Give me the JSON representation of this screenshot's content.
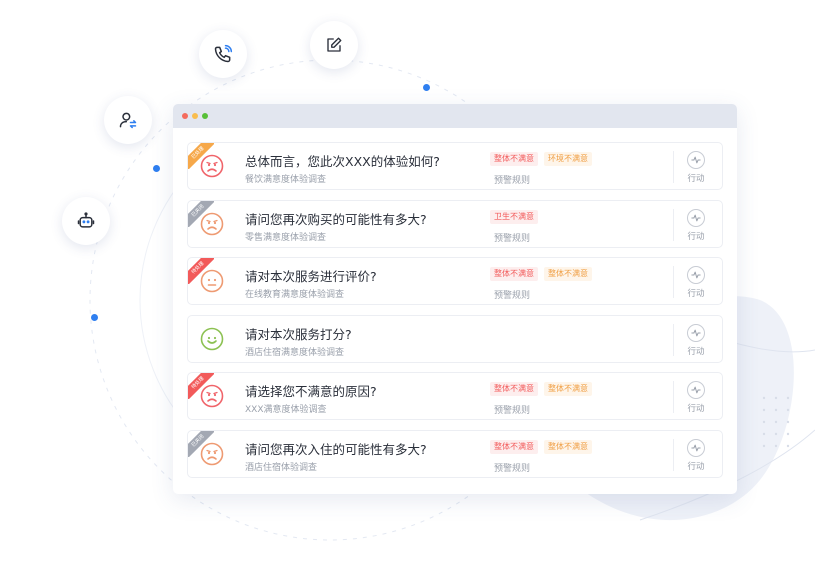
{
  "colors": {
    "accent": "#2f7ff0",
    "red_face": "#f0646a",
    "orange_face": "#ee9a72",
    "green_face": "#8cc152"
  },
  "side_icons": [
    "phone-icon",
    "edit-icon",
    "user-switch-icon",
    "robot-icon"
  ],
  "window": {
    "traffic_lights": [
      "#f46b5d",
      "#f9bd4e",
      "#57c038"
    ]
  },
  "rows": [
    {
      "ribbon": "已处理",
      "ribbon_color": "#f6a84a",
      "face": "sad",
      "face_color": "#f0646a",
      "question": "总体而言，您此次XXX的体验如何?",
      "survey": "餐饮满意度体验调查",
      "tags": [
        {
          "text": "整体不满意",
          "style": "red"
        },
        {
          "text": "环境不满意",
          "style": "orange"
        }
      ],
      "rule": "预警规则",
      "action": "行动"
    },
    {
      "ribbon": "已关闭",
      "ribbon_color": "#a3a8b3",
      "face": "sad",
      "face_color": "#ee9a72",
      "question": "请问您再次购买的可能性有多大?",
      "survey": "零售满意度体验调查",
      "tags": [
        {
          "text": "卫生不满意",
          "style": "red"
        }
      ],
      "rule": "预警规则",
      "action": "行动"
    },
    {
      "ribbon": "待处理",
      "ribbon_color": "#f25a5a",
      "face": "neutral",
      "face_color": "#ee9a72",
      "question": "请对本次服务进行评价?",
      "survey": "在线教育满意度体验调查",
      "tags": [
        {
          "text": "整体不满意",
          "style": "red"
        },
        {
          "text": "整体不满意",
          "style": "orange"
        }
      ],
      "rule": "预警规则",
      "action": "行动"
    },
    {
      "ribbon": "",
      "ribbon_color": "",
      "face": "happy",
      "face_color": "#8cc152",
      "question": "请对本次服务打分?",
      "survey": "酒店住宿满意度体验调查",
      "tags": [],
      "rule": "",
      "action": "行动"
    },
    {
      "ribbon": "待处理",
      "ribbon_color": "#f25a5a",
      "face": "sad",
      "face_color": "#f0646a",
      "question": "请选择您不满意的原因?",
      "survey": "XXX满意度体验调查",
      "tags": [
        {
          "text": "整体不满意",
          "style": "red"
        },
        {
          "text": "整体不满意",
          "style": "orange"
        }
      ],
      "rule": "预警规则",
      "action": "行动"
    },
    {
      "ribbon": "已关闭",
      "ribbon_color": "#a3a8b3",
      "face": "sad",
      "face_color": "#ee9a72",
      "question": "请问您再次入住的可能性有多大?",
      "survey": "酒店住宿体验调查",
      "tags": [
        {
          "text": "整体不满意",
          "style": "red"
        },
        {
          "text": "整体不满意",
          "style": "orange"
        }
      ],
      "rule": "预警规则",
      "action": "行动"
    }
  ]
}
